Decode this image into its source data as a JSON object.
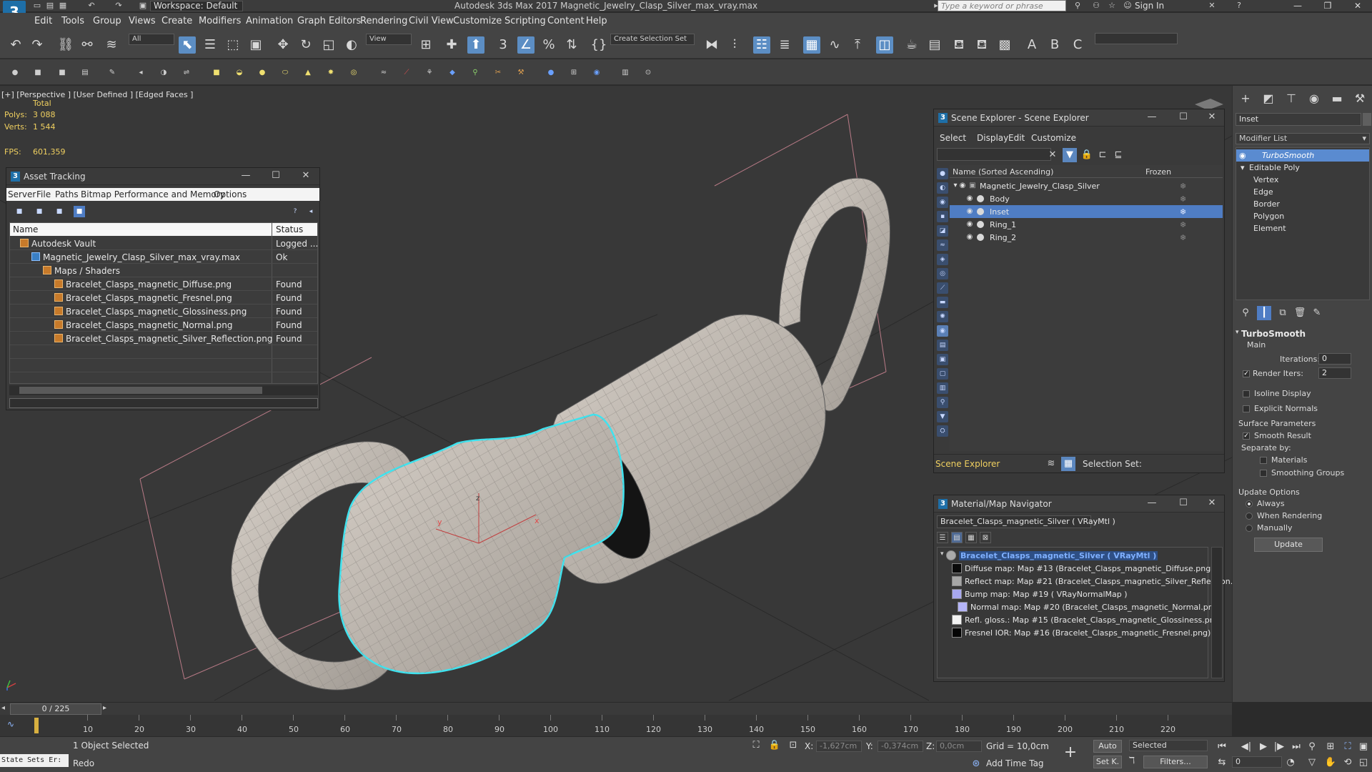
{
  "titlebar": {
    "logo": "3",
    "workspace": "Workspace: Default",
    "window_title": "Autodesk 3ds Max 2017      Magnetic_Jewelry_Clasp_Silver_max_vray.max",
    "search_placeholder": "Type a keyword or phrase",
    "sign_in": "Sign In"
  },
  "menu": [
    "Edit",
    "Tools",
    "Group",
    "Views",
    "Create",
    "Modifiers",
    "Animation",
    "Graph Editors",
    "Rendering",
    "Civil View",
    "Customize",
    "Scripting",
    "Content",
    "Help"
  ],
  "toolbar": {
    "filter_combo": "All",
    "refcoord_combo": "View",
    "selection_set": "Create Selection Set"
  },
  "viewport": {
    "label": "[+] [Perspective ]  [User Defined ]  [Edged Faces ]",
    "stats_header": "Total",
    "polys_label": "Polys:",
    "polys_value": "3 088",
    "verts_label": "Verts:",
    "verts_value": "1 544",
    "fps_label": "FPS:",
    "fps_value": "601,359",
    "gizmo_x": "x",
    "gizmo_y": "y",
    "gizmo_z": "z"
  },
  "asset_tracking": {
    "title": "Asset Tracking",
    "menu": [
      "Server",
      "File",
      "Paths",
      "Bitmap Performance and Memory",
      "Options"
    ],
    "col_name": "Name",
    "col_status": "Status",
    "rows": [
      {
        "name": "Autodesk Vault",
        "status": "Logged ..."
      },
      {
        "name": "Magnetic_Jewelry_Clasp_Silver_max_vray.max",
        "status": "Ok"
      },
      {
        "name": "Maps / Shaders",
        "status": ""
      },
      {
        "name": "Bracelet_Clasps_magnetic_Diffuse.png",
        "status": "Found"
      },
      {
        "name": "Bracelet_Clasps_magnetic_Fresnel.png",
        "status": "Found"
      },
      {
        "name": "Bracelet_Clasps_magnetic_Glossiness.png",
        "status": "Found"
      },
      {
        "name": "Bracelet_Clasps_magnetic_Normal.png",
        "status": "Found"
      },
      {
        "name": "Bracelet_Clasps_magnetic_Silver_Reflection.png",
        "status": "Found"
      }
    ]
  },
  "scene_explorer": {
    "title": "Scene Explorer - Scene Explorer",
    "menu": [
      "Select",
      "Display",
      "Edit",
      "Customize"
    ],
    "col_name": "Name (Sorted Ascending)",
    "col_frozen": "Frozen",
    "root": "Magnetic_Jewelry_Clasp_Silver",
    "children": [
      "Body",
      "Inset",
      "Ring_1",
      "Ring_2"
    ],
    "selected": "Inset",
    "footer_combo": "Scene Explorer",
    "footer_selset": "Selection Set:"
  },
  "material_navigator": {
    "title": "Material/Map Navigator",
    "current": "Bracelet_Clasps_magnetic_Silver  ( VRayMtl )",
    "root": "Bracelet_Clasps_magnetic_Silver  ( VRayMtl )",
    "maps": [
      {
        "label": "Diffuse map: Map #13 (Bracelet_Clasps_magnetic_Diffuse.png)",
        "swatch": "#0a0a0a",
        "indent": 0
      },
      {
        "label": "Reflect map: Map #21 (Bracelet_Clasps_magnetic_Silver_Reflection.png)",
        "swatch": "#a6a6a6",
        "indent": 0
      },
      {
        "label": "Bump map: Map #19  ( VRayNormalMap )",
        "swatch": "#a9a9f0",
        "indent": 0
      },
      {
        "label": "Normal map: Map #20 (Bracelet_Clasps_magnetic_Normal.png)",
        "swatch": "#b4b4f8",
        "indent": 1
      },
      {
        "label": "Refl. gloss.: Map #15 (Bracelet_Clasps_magnetic_Glossiness.png)",
        "swatch": "#f2f2f2",
        "indent": 0
      },
      {
        "label": "Fresnel IOR: Map #16 (Bracelet_Clasps_magnetic_Fresnel.png)",
        "swatch": "#050505",
        "indent": 0
      }
    ]
  },
  "command_panel": {
    "object_name": "Inset",
    "modifier_list": "Modifier List",
    "stack": [
      {
        "label": "TurboSmooth",
        "selected": true,
        "level": 0
      },
      {
        "label": "Editable Poly",
        "selected": false,
        "level": 0
      },
      {
        "label": "Vertex",
        "selected": false,
        "level": 1
      },
      {
        "label": "Edge",
        "selected": false,
        "level": 1
      },
      {
        "label": "Border",
        "selected": false,
        "level": 1
      },
      {
        "label": "Polygon",
        "selected": false,
        "level": 1
      },
      {
        "label": "Element",
        "selected": false,
        "level": 1
      }
    ],
    "turbosmooth": {
      "title": "TurboSmooth",
      "main": "Main",
      "iterations_label": "Iterations:",
      "iterations_value": "0",
      "render_iters_label": "Render Iters:",
      "render_iters_value": "2",
      "isoline": "Isoline Display",
      "explicit_normals": "Explicit Normals",
      "surface_params": "Surface Parameters",
      "smooth_result": "Smooth Result",
      "separate_by": "Separate by:",
      "materials": "Materials",
      "smoothing_groups": "Smoothing Groups",
      "update_options": "Update Options",
      "always": "Always",
      "when_rendering": "When Rendering",
      "manually": "Manually",
      "update_button": "Update"
    }
  },
  "timeline": {
    "frame": "0 / 225",
    "ticks": [
      "10",
      "20",
      "30",
      "40",
      "50",
      "60",
      "70",
      "80",
      "90",
      "100",
      "110",
      "120",
      "130",
      "140",
      "150",
      "160",
      "170",
      "180",
      "190",
      "200",
      "210",
      "220"
    ]
  },
  "status": {
    "maxscript": "State Sets Er:",
    "selection": "1 Object Selected",
    "prompt": "Redo",
    "x_label": "X:",
    "x_value": "-1,627cm",
    "y_label": "Y:",
    "y_value": "-0,374cm",
    "z_label": "Z:",
    "z_value": "0,0cm",
    "grid": "Grid = 10,0cm",
    "add_time_tag": "Add Time Tag",
    "auto": "Auto",
    "set_k": "Set K.",
    "selected_combo": "Selected",
    "filters": "Filters...",
    "frame_field": "0"
  }
}
